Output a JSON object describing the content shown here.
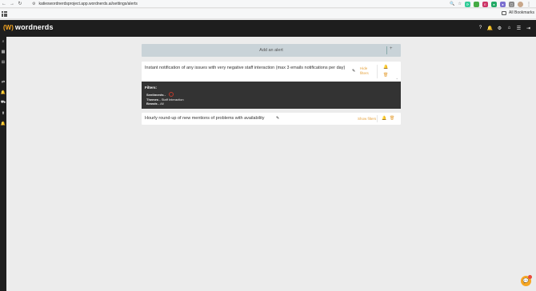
{
  "browser": {
    "url": "katieswordnerdsproject.app.wordnerds.ai/settings/alerts",
    "bookmarks_label": "All Bookmarks"
  },
  "app": {
    "logo_mark": "(W)",
    "logo_text": "wordnerds"
  },
  "add_alert": {
    "label": "Add an alert",
    "plus": "+"
  },
  "alerts": [
    {
      "text": "Instant notification of any issues with very negative staff interaction (max 3 emails notifications per day)",
      "toggle_label": "Hide filters"
    },
    {
      "text": "Hourly round-up of new mentions of problems with availability",
      "toggle_label": "Show filters"
    }
  ],
  "filters": {
    "title": "Filters:",
    "sentiments_label": "Sentiments -",
    "themes_label": "Themes -",
    "themes_value": "Staff Interaction",
    "brands_label": "Brands -",
    "brands_value": "All"
  },
  "colors": {
    "accent": "#e6a23c",
    "header_bg": "#1e1e1e",
    "filter_bg": "#333333"
  }
}
